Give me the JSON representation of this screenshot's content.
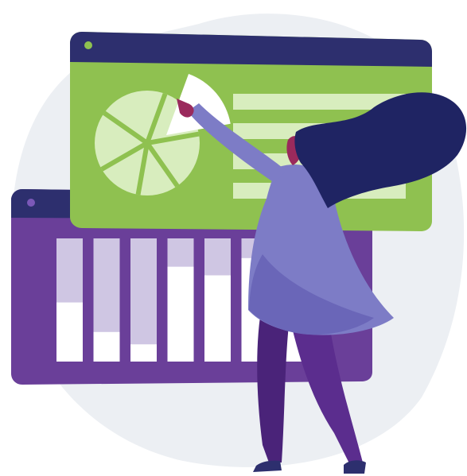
{
  "illustration": {
    "background_blob_color": "#eceff3",
    "back_window": {
      "frame_color": "#6a3f99",
      "titlebar_color": "#2d2f6e",
      "dot_color": "#7b58b8",
      "bar_track_color": "#cfc6e3",
      "bar_fill_color": "#ffffff",
      "bar_fill_levels": [
        0.48,
        0.24,
        0.14,
        0.77,
        0.7,
        0.84,
        0.7
      ]
    },
    "front_window": {
      "frame_color": "#8fc150",
      "titlebar_color": "#2d2f6e",
      "dot_color": "#8fc150",
      "pie_color": "#d8edbe",
      "pie_highlight_color": "#ffffff",
      "pie_slice_count": 6,
      "text_line_color": "#d8edbe",
      "text_line_count": 4
    },
    "person": {
      "top_color": "#7d7cc6",
      "pants_color": "#5b2d8e",
      "hair_color": "#1f2463",
      "skin_color": "#9a2a5c",
      "shoe_color": "#2d2f6e"
    }
  }
}
